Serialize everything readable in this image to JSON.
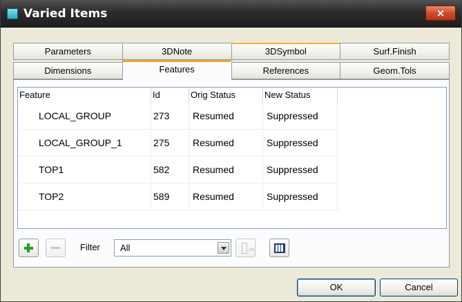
{
  "window": {
    "title": "Varied Items",
    "close_label": "×"
  },
  "tabs": {
    "back_row": [
      {
        "label": "Parameters"
      },
      {
        "label": "3DNote"
      },
      {
        "label": "3DSymbol"
      },
      {
        "label": "Surf.Finish"
      }
    ],
    "front_row": [
      {
        "label": "Dimensions"
      },
      {
        "label": "Features",
        "active": true
      },
      {
        "label": "References"
      },
      {
        "label": "Geom.Tols"
      }
    ]
  },
  "table": {
    "columns": [
      "Feature",
      "Id",
      "Orig Status",
      "New  Status"
    ],
    "rows": [
      [
        "LOCAL_GROUP",
        "273",
        "Resumed",
        "Suppressed"
      ],
      [
        "LOCAL_GROUP_1",
        "275",
        "Resumed",
        "Suppressed"
      ],
      [
        "TOP1",
        "582",
        "Resumed",
        "Suppressed"
      ],
      [
        "TOP2",
        "589",
        "Resumed",
        "Suppressed"
      ]
    ]
  },
  "toolbar": {
    "filter_label": "Filter",
    "filter_value": "All",
    "icons": {
      "add": "plus-icon",
      "remove": "minus-icon",
      "list": "list-icon",
      "columns": "columns-icon"
    }
  },
  "buttons": {
    "ok_label": "OK",
    "cancel_label": "Cancel"
  },
  "colors": {
    "accent_tab": "#f2a630",
    "titlebar": "#2c2c2c",
    "close": "#cf4b2a",
    "add_icon": "#22a022"
  }
}
